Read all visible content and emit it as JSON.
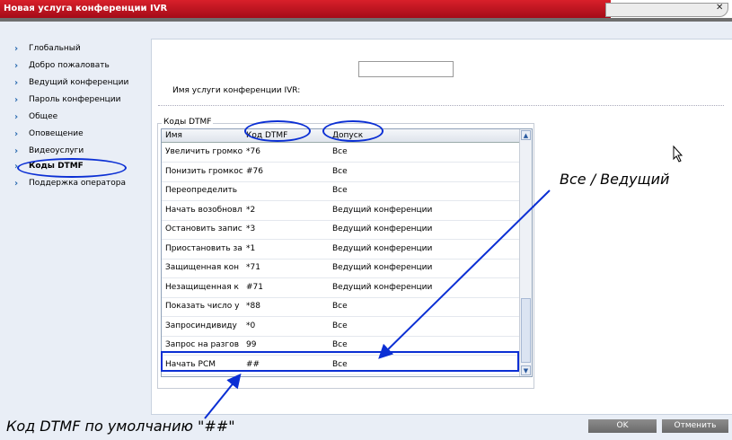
{
  "window": {
    "title": "Новая услуга конференции IVR"
  },
  "nav": {
    "items": [
      {
        "label": "Глобальный"
      },
      {
        "label": "Добро пожаловать"
      },
      {
        "label": "Ведущий конференции"
      },
      {
        "label": "Пароль конференции"
      },
      {
        "label": "Общее"
      },
      {
        "label": "Оповещение"
      },
      {
        "label": "Видеоуслуги"
      },
      {
        "label": "Коды DTMF",
        "active": true
      },
      {
        "label": "Поддержка оператора"
      }
    ]
  },
  "form": {
    "ivr_name_label": "Имя услуги конференции IVR:",
    "ivr_name_value": ""
  },
  "dtmf": {
    "legend": "Коды DTMF",
    "columns": [
      "Имя",
      "Код DTMF",
      "Допуск"
    ],
    "rows": [
      {
        "name": "Увеличить громко",
        "code": "*76",
        "perm": "Все"
      },
      {
        "name": "Понизить громкос",
        "code": "#76",
        "perm": "Все"
      },
      {
        "name": "Переопределить",
        "code": "",
        "perm": "Все"
      },
      {
        "name": "Начать возобновл",
        "code": "*2",
        "perm": "Ведущий конференции"
      },
      {
        "name": "Остановить запис",
        "code": "*3",
        "perm": "Ведущий конференции"
      },
      {
        "name": "Приостановить за",
        "code": "*1",
        "perm": "Ведущий конференции"
      },
      {
        "name": "Защищенная кон",
        "code": "*71",
        "perm": "Ведущий конференции"
      },
      {
        "name": "Незащищенная к",
        "code": "#71",
        "perm": "Ведущий конференции"
      },
      {
        "name": "Показать число у",
        "code": "*88",
        "perm": "Все"
      },
      {
        "name": "Запросиндивиду",
        "code": "*0",
        "perm": "Все"
      },
      {
        "name": "Запрос на разгов",
        "code": "99",
        "perm": "Все"
      },
      {
        "name": "Начать PCM",
        "code": "##",
        "perm": "Все"
      }
    ]
  },
  "buttons": {
    "ok": "OK",
    "cancel": "Отменить"
  },
  "annotations": {
    "top": "Все / Ведущий",
    "bottom": "Код DTMF по умолчанию \"##\""
  },
  "colors": {
    "titlebar": "#c8141f",
    "annotation": "#0b2fd4"
  }
}
